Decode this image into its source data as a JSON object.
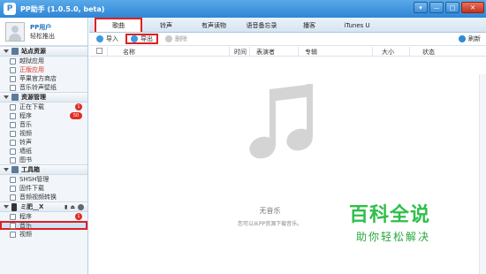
{
  "window": {
    "logo": "P",
    "title": "PP助手 (1.0.5.0, beta)",
    "controls": [
      "▾",
      "—",
      "□",
      "✕"
    ]
  },
  "user": {
    "name": "PP用户",
    "logout": "轻松推出"
  },
  "sections": [
    {
      "title": "站点资源",
      "items": [
        {
          "label": "越狱应用",
          "state": "normal"
        },
        {
          "label": "正版应用",
          "state": "red"
        },
        {
          "label": "苹果官方商店",
          "state": "normal"
        },
        {
          "label": "音乐铃声壁纸",
          "state": "normal"
        }
      ]
    },
    {
      "title": "资源管理",
      "items": [
        {
          "label": "正在下载",
          "badge": "1"
        },
        {
          "label": "程序",
          "badge": "50"
        },
        {
          "label": "音乐"
        },
        {
          "label": "视频"
        },
        {
          "label": "铃声"
        },
        {
          "label": "墙纸"
        },
        {
          "label": "图书"
        }
      ]
    },
    {
      "title": "工具箱",
      "items": [
        {
          "label": "SHSH管理"
        },
        {
          "label": "固件下载"
        },
        {
          "label": "音频视频转换"
        }
      ]
    }
  ],
  "device": {
    "title": "ミ肥__X",
    "items": [
      {
        "label": "程序",
        "badge": "1"
      },
      {
        "label": "音乐",
        "selected": true
      },
      {
        "label": "视频"
      }
    ]
  },
  "tabs": [
    "歌曲",
    "铃声",
    "有声读物",
    "语音备忘录",
    "播客",
    "iTunes U"
  ],
  "toolbar": {
    "import": "导入",
    "export": "导出",
    "delete": "删除",
    "refresh": "刷新"
  },
  "columns": [
    "名称",
    "时间",
    "表演者",
    "专辑",
    "大小",
    "状态"
  ],
  "empty": {
    "title": "无音乐",
    "subtitle": "您可以从PP资源下载音乐。"
  },
  "watermark": {
    "main": "百科全说",
    "sub": "助你轻松解决"
  },
  "colors": {
    "accent": "#2f86d6",
    "highlight_border": "#e02020",
    "badge": "#e02d20",
    "watermark": "#2fbf4a"
  }
}
